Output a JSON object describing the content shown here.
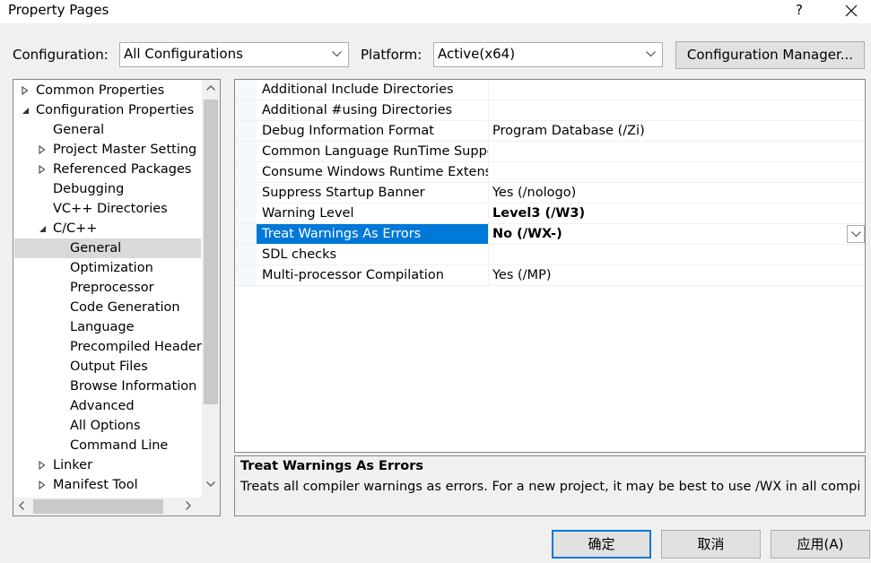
{
  "window": {
    "title": "Property Pages",
    "help_label": "?"
  },
  "toolbar": {
    "configuration_label": "Configuration:",
    "configuration_value": "All Configurations",
    "platform_label": "Platform:",
    "platform_value": "Active(x64)",
    "config_manager_label": "Configuration Manager..."
  },
  "tree": {
    "items": [
      {
        "label": "Common Properties",
        "twisty": "collapsed"
      },
      {
        "label": "Configuration Properties",
        "twisty": "expanded"
      },
      {
        "label": "General",
        "twisty": "none"
      },
      {
        "label": "Project Master Setting",
        "twisty": "collapsed"
      },
      {
        "label": "Referenced Packages",
        "twisty": "collapsed"
      },
      {
        "label": "Debugging",
        "twisty": "none"
      },
      {
        "label": "VC++ Directories",
        "twisty": "none"
      },
      {
        "label": "C/C++",
        "twisty": "expanded"
      },
      {
        "label": "General",
        "twisty": "none",
        "selected": true
      },
      {
        "label": "Optimization",
        "twisty": "none"
      },
      {
        "label": "Preprocessor",
        "twisty": "none"
      },
      {
        "label": "Code Generation",
        "twisty": "none"
      },
      {
        "label": "Language",
        "twisty": "none"
      },
      {
        "label": "Precompiled Headers",
        "twisty": "none"
      },
      {
        "label": "Output Files",
        "twisty": "none"
      },
      {
        "label": "Browse Information",
        "twisty": "none"
      },
      {
        "label": "Advanced",
        "twisty": "none"
      },
      {
        "label": "All Options",
        "twisty": "none"
      },
      {
        "label": "Command Line",
        "twisty": "none"
      },
      {
        "label": "Linker",
        "twisty": "collapsed"
      },
      {
        "label": "Manifest Tool",
        "twisty": "collapsed"
      }
    ]
  },
  "grid": {
    "rows": [
      {
        "name": "Additional Include Directories",
        "value": ""
      },
      {
        "name": "Additional #using Directories",
        "value": ""
      },
      {
        "name": "Debug Information Format",
        "value": "Program Database (/Zi)"
      },
      {
        "name": "Common Language RunTime Support",
        "value": ""
      },
      {
        "name": "Consume Windows Runtime Extension",
        "value": ""
      },
      {
        "name": "Suppress Startup Banner",
        "value": "Yes (/nologo)"
      },
      {
        "name": "Warning Level",
        "value": "Level3 (/W3)",
        "bold": true
      },
      {
        "name": "Treat Warnings As Errors",
        "value": "No (/WX-)",
        "bold": true,
        "selected": true
      },
      {
        "name": "SDL checks",
        "value": ""
      },
      {
        "name": "Multi-processor Compilation",
        "value": "Yes (/MP)"
      }
    ]
  },
  "description": {
    "title": "Treat Warnings As Errors",
    "text": "Treats all compiler warnings as errors. For a new project, it may be best to use /WX in all compilations; resolving all warnings will ensure the fewest possible hard-to-find code defects."
  },
  "buttons": {
    "ok": "确定",
    "cancel": "取消",
    "apply": "应用(A)"
  },
  "colors": {
    "selection": "#0078d7",
    "tree_selection": "#d9d9d9",
    "window": "#f0f0f0"
  }
}
